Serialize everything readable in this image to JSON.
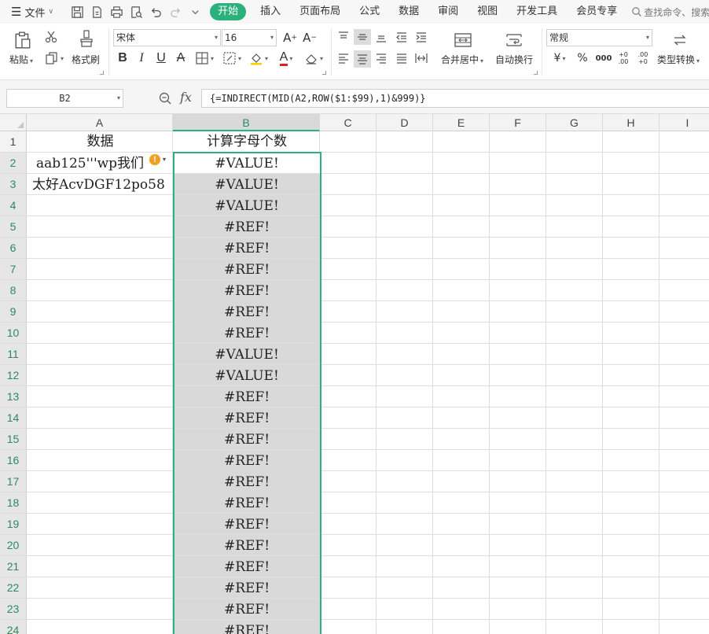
{
  "menubar": {
    "file_label": "文件",
    "tabs": [
      {
        "label": "开始",
        "active": true
      },
      {
        "label": "插入"
      },
      {
        "label": "页面布局"
      },
      {
        "label": "公式"
      },
      {
        "label": "数据"
      },
      {
        "label": "审阅"
      },
      {
        "label": "视图"
      },
      {
        "label": "开发工具"
      },
      {
        "label": "会员专享"
      }
    ],
    "search_placeholder": "查找命令、搜索"
  },
  "ribbon": {
    "paste_label": "粘贴",
    "format_painter_label": "格式刷",
    "font_name": "宋体",
    "font_size": "16",
    "grow_font_label": "A",
    "shrink_font_label": "A",
    "bold_label": "B",
    "italic_label": "I",
    "underline_label": "U",
    "strike_label": "A",
    "font_color_label": "A",
    "merge_label": "合并居中",
    "wrap_label": "自动换行",
    "number_format": "常规",
    "currency_label": "¥",
    "percent_label": "%",
    "thousands_label": "000",
    "inc_decimal_label": "+0 .00",
    "dec_decimal_label": ".00 +0",
    "convert_label": "类型转换"
  },
  "formula_bar": {
    "name_box": "B2",
    "fx_label": "fx",
    "formula": "{=INDIRECT(MID(A2,ROW($1:$99),1)&999)}"
  },
  "sheet": {
    "columns": [
      "A",
      "B",
      "C",
      "D",
      "E",
      "F",
      "G",
      "H",
      "I"
    ],
    "selected_column": "B",
    "rows": [
      "1",
      "2",
      "3",
      "4",
      "5",
      "6",
      "7",
      "8",
      "9",
      "10",
      "11",
      "12",
      "13",
      "14",
      "15",
      "16",
      "17",
      "18",
      "19",
      "20",
      "21",
      "22",
      "23",
      "24"
    ],
    "header_row": {
      "A": "数据",
      "B": "计算字母个数"
    },
    "column_a": [
      "aab125'''wp我们",
      "太好AcvDGF12po58"
    ],
    "column_b": [
      "#VALUE!",
      "#VALUE!",
      "#VALUE!",
      "#REF!",
      "#REF!",
      "#REF!",
      "#REF!",
      "#REF!",
      "#REF!",
      "#VALUE!",
      "#VALUE!",
      "#REF!",
      "#REF!",
      "#REF!",
      "#REF!",
      "#REF!",
      "#REF!",
      "#REF!",
      "#REF!",
      "#REF!",
      "#REF!",
      "#REF!",
      "#REF!"
    ],
    "error_indicator": "!"
  },
  "colors": {
    "accent": "#2bb17b",
    "selection_fill": "#d9d9d9",
    "warning": "#f0a020"
  }
}
